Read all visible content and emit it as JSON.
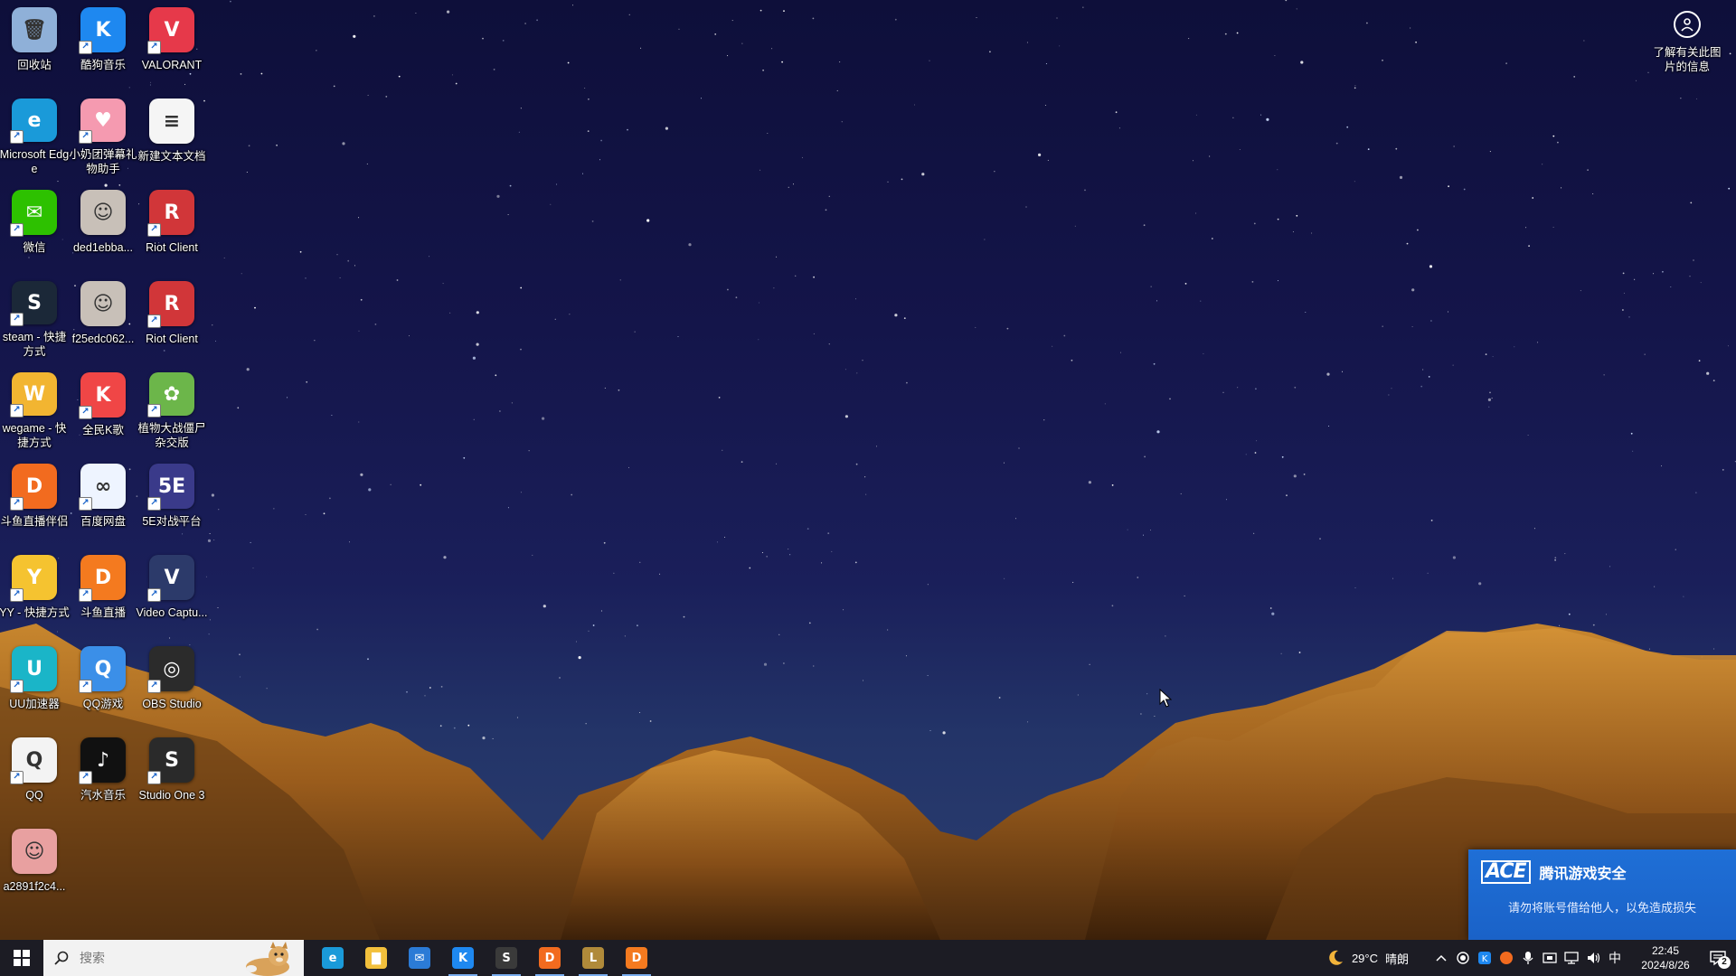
{
  "desktop": {
    "icons": [
      {
        "label": "回收站",
        "glyph": "🗑",
        "color": "#8fb0d8",
        "icon": "recycle-bin-icon",
        "shortcut": false
      },
      {
        "label": "酷狗音乐",
        "glyph": "K",
        "color": "#1e88f0",
        "icon": "kugou-music-icon",
        "shortcut": true
      },
      {
        "label": "VALORANT",
        "glyph": "V",
        "color": "#e6394a",
        "icon": "valorant-icon",
        "shortcut": true
      },
      {
        "label": "Microsoft Edge",
        "glyph": "e",
        "color": "#1a9ad9",
        "icon": "edge-icon",
        "shortcut": true
      },
      {
        "label": "小奶团弹幕礼物助手",
        "glyph": "♥",
        "color": "#f59ab0",
        "icon": "danmaku-helper-icon",
        "shortcut": true
      },
      {
        "label": "新建文本文档",
        "glyph": "≡",
        "color": "#f5f5f5",
        "icon": "text-document-icon",
        "shortcut": false
      },
      {
        "label": "微信",
        "glyph": "✉",
        "color": "#2dc100",
        "icon": "wechat-icon",
        "shortcut": true
      },
      {
        "label": "ded1ebba...",
        "glyph": "☺",
        "color": "#c8c0b8",
        "icon": "image-file-icon",
        "shortcut": false
      },
      {
        "label": "Riot Client",
        "glyph": "R",
        "color": "#d13639",
        "icon": "riot-client-icon",
        "shortcut": true
      },
      {
        "label": "steam - 快捷方式",
        "glyph": "S",
        "color": "#1b2838",
        "icon": "steam-icon",
        "shortcut": true
      },
      {
        "label": "f25edc062...",
        "glyph": "☺",
        "color": "#c8c0b8",
        "icon": "image-file-icon",
        "shortcut": false
      },
      {
        "label": "Riot Client",
        "glyph": "R",
        "color": "#d13639",
        "icon": "riot-client-icon",
        "shortcut": true
      },
      {
        "label": "wegame - 快捷方式",
        "glyph": "W",
        "color": "#f2b531",
        "icon": "wegame-icon",
        "shortcut": true
      },
      {
        "label": "全民K歌",
        "glyph": "K",
        "color": "#f04646",
        "icon": "quanmin-kge-icon",
        "shortcut": true
      },
      {
        "label": "植物大战僵尸杂交版",
        "glyph": "✿",
        "color": "#6cb64a",
        "icon": "pvz-icon",
        "shortcut": true
      },
      {
        "label": "斗鱼直播伴侣",
        "glyph": "D",
        "color": "#f26b1f",
        "icon": "douyu-companion-icon",
        "shortcut": true
      },
      {
        "label": "百度网盘",
        "glyph": "∞",
        "color": "#eef4ff",
        "icon": "baidu-netdisk-icon",
        "shortcut": true
      },
      {
        "label": "5E对战平台",
        "glyph": "5E",
        "color": "#3a3a8a",
        "icon": "5e-platform-icon",
        "shortcut": true
      },
      {
        "label": "YY - 快捷方式",
        "glyph": "Y",
        "color": "#f5c330",
        "icon": "yy-icon",
        "shortcut": true
      },
      {
        "label": "斗鱼直播",
        "glyph": "D",
        "color": "#f47a1f",
        "icon": "douyu-live-icon",
        "shortcut": true
      },
      {
        "label": "Video Captu...",
        "glyph": "V",
        "color": "#2c3a6a",
        "icon": "video-capture-icon",
        "shortcut": true
      },
      {
        "label": "UU加速器",
        "glyph": "U",
        "color": "#1ab5c8",
        "icon": "uu-accelerator-icon",
        "shortcut": true
      },
      {
        "label": "QQ游戏",
        "glyph": "Q",
        "color": "#3b8fe8",
        "icon": "qq-game-icon",
        "shortcut": true
      },
      {
        "label": "OBS Studio",
        "glyph": "◎",
        "color": "#2b2b2b",
        "icon": "obs-studio-icon",
        "shortcut": true
      },
      {
        "label": "QQ",
        "glyph": "Q",
        "color": "#f3f3f3",
        "icon": "qq-icon",
        "shortcut": true
      },
      {
        "label": "汽水音乐",
        "glyph": "♪",
        "color": "#111111",
        "icon": "qishui-music-icon",
        "shortcut": true
      },
      {
        "label": "Studio One 3",
        "glyph": "S",
        "color": "#2a2a2a",
        "icon": "studio-one-icon",
        "shortcut": true
      },
      {
        "label": "a2891f2c4...",
        "glyph": "☺",
        "color": "#e8a0a0",
        "icon": "image-file-icon",
        "shortcut": false
      }
    ],
    "info_label": "了解有关此图片的信息"
  },
  "notification": {
    "logo": "ACE",
    "title": "腾讯游戏安全",
    "message": "请勿将账号借给他人，以免造成损失"
  },
  "taskbar": {
    "search_placeholder": "搜索",
    "apps": [
      {
        "icon": "edge-icon",
        "glyph": "e",
        "color": "#1a9ad9",
        "active": false
      },
      {
        "icon": "file-explorer-icon",
        "glyph": "▇",
        "color": "#f2c03c",
        "active": false
      },
      {
        "icon": "mail-icon",
        "glyph": "✉",
        "color": "#2b7bd6",
        "active": false
      },
      {
        "icon": "kugou-music-icon",
        "glyph": "K",
        "color": "#1e88f0",
        "active": true
      },
      {
        "icon": "studio-one-icon",
        "glyph": "S",
        "color": "#3a3a3a",
        "active": true
      },
      {
        "icon": "douyu-companion-icon",
        "glyph": "D",
        "color": "#f26b1f",
        "active": true
      },
      {
        "icon": "league-client-icon",
        "glyph": "L",
        "color": "#b08a3a",
        "active": true
      },
      {
        "icon": "douyu-live-icon",
        "glyph": "D",
        "color": "#f47a1f",
        "active": true
      }
    ],
    "weather": {
      "temp": "29°C",
      "condition": "晴朗"
    },
    "ime": "中",
    "time": "22:45",
    "date": "2024/8/26",
    "notification_count": "2"
  }
}
